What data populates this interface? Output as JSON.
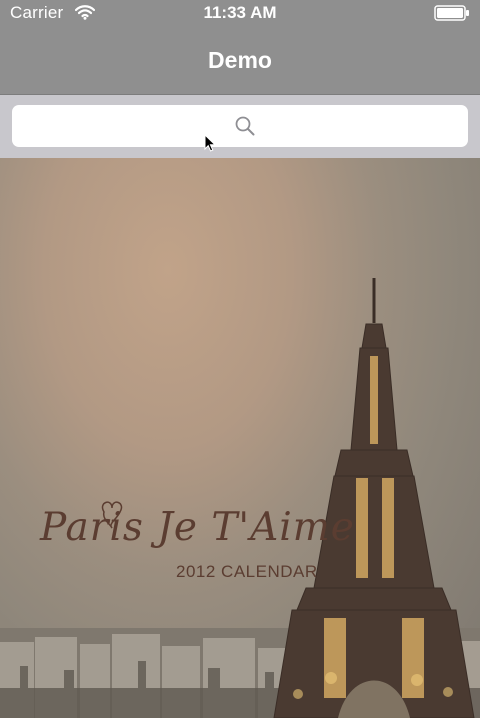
{
  "status_bar": {
    "carrier": "Carrier",
    "time": "11:33 AM",
    "wifi_icon": "wifi-icon",
    "battery_icon": "battery-icon"
  },
  "navigation": {
    "title": "Demo"
  },
  "search": {
    "value": "",
    "placeholder": "",
    "icon": "search-icon"
  },
  "content": {
    "poster_title": "Paris Je T'Aime",
    "poster_subtitle": "2012 CALENDAR"
  },
  "colors": {
    "nav_background": "#8f8f8f",
    "search_background": "#c8c7cc",
    "search_field": "#ffffff",
    "poster_text": "#5b3d31"
  }
}
